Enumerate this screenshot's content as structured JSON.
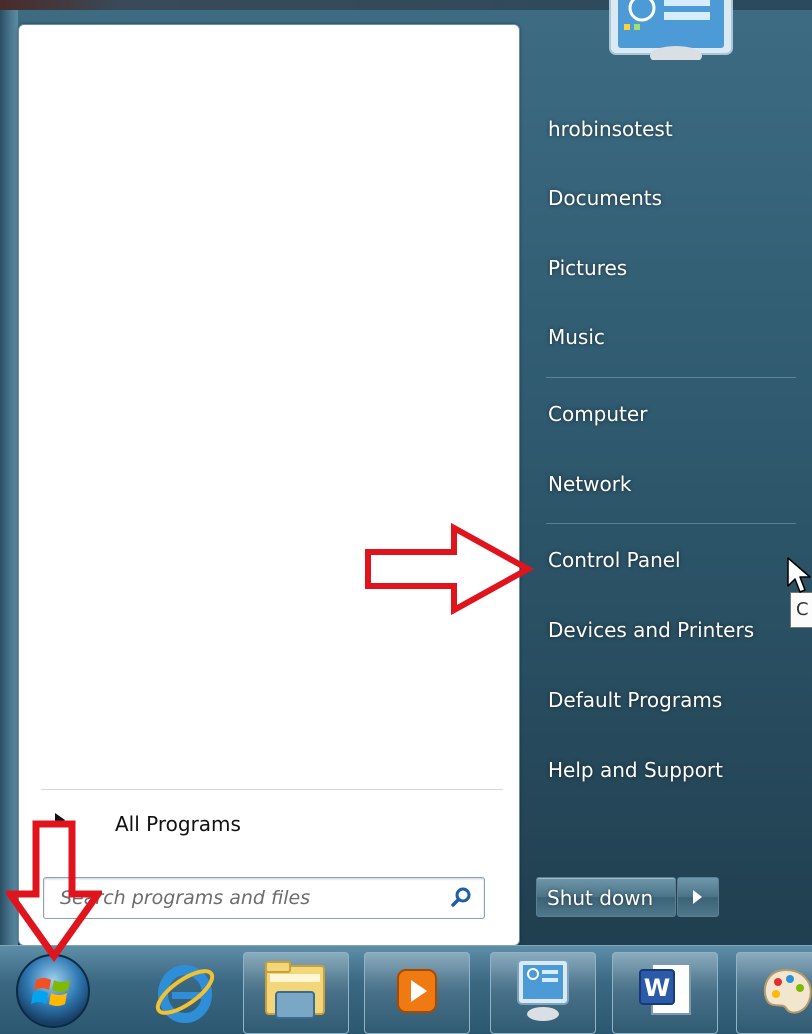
{
  "start_menu": {
    "all_programs_label": "All Programs",
    "search_placeholder": "Search programs and files",
    "right_items": [
      "hrobinsotest",
      "Documents",
      "Pictures",
      "Music",
      "Computer",
      "Network",
      "Control Panel",
      "Devices and Printers",
      "Default Programs",
      "Help and Support"
    ],
    "shutdown_label": "Shut down",
    "tooltip_text": "C"
  },
  "icons": {
    "search": "search-icon",
    "start": "windows-orb-icon",
    "ie": "internet-explorer-icon",
    "explorer": "file-explorer-icon",
    "media": "media-player-icon",
    "control_panel": "control-panel-icon",
    "word": "word-icon",
    "paint": "paint-icon"
  },
  "colors": {
    "annotation_red": "#e0141c",
    "menu_text": "#ffffff",
    "pane_bg": "#ffffff"
  }
}
